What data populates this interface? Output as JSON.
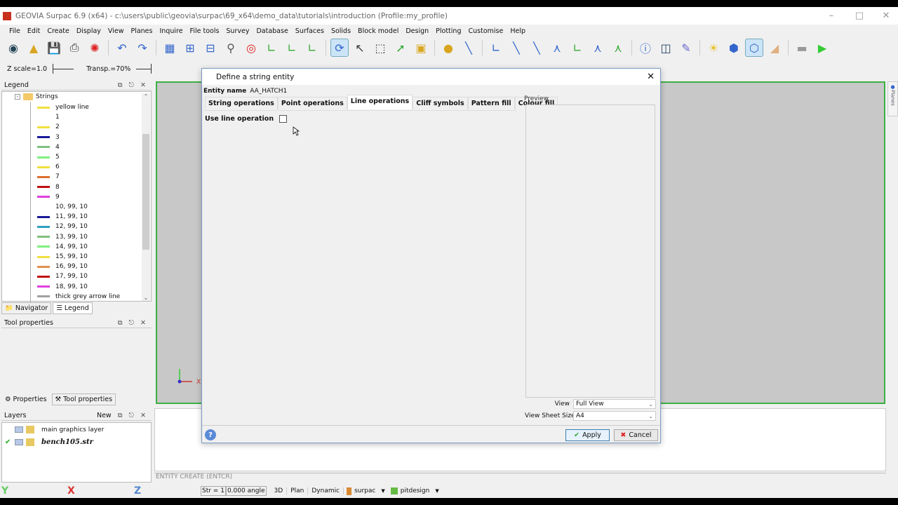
{
  "window": {
    "title": "GEOVIA Surpac 6.9 (x64) - c:\\users\\public\\geovia\\surpac\\69_x64\\demo_data\\tutorials\\introduction (Profile:my_profile)"
  },
  "menu": [
    "File",
    "Edit",
    "Create",
    "Display",
    "View",
    "Planes",
    "Inquire",
    "File tools",
    "Survey",
    "Database",
    "Surfaces",
    "Solids",
    "Block model",
    "Design",
    "Plotting",
    "Customise",
    "Help"
  ],
  "toolbar2": {
    "zscale": "Z scale=1.0",
    "transp": "Transp.=70%"
  },
  "legend": {
    "title": "Legend",
    "root": "Strings",
    "items": [
      {
        "label": "yellow line",
        "color": "#f0e040"
      },
      {
        "label": "1",
        "color": "#bbbbbb"
      },
      {
        "label": "2",
        "color": "#f0e040"
      },
      {
        "label": "3",
        "color": "#1a1a9a"
      },
      {
        "label": "4",
        "color": "#80c080"
      },
      {
        "label": "5",
        "color": "#80f080"
      },
      {
        "label": "6",
        "color": "#f0e040"
      },
      {
        "label": "7",
        "color": "#e07030"
      },
      {
        "label": "8",
        "color": "#c01010"
      },
      {
        "label": "9",
        "color": "#e040e0"
      },
      {
        "label": "10, 99, 10",
        "color": "#bbbbbb"
      },
      {
        "label": "11, 99, 10",
        "color": "#1a1a9a"
      },
      {
        "label": "12, 99, 10",
        "color": "#30a0c0"
      },
      {
        "label": "13, 99, 10",
        "color": "#80c080"
      },
      {
        "label": "14, 99, 10",
        "color": "#80f080"
      },
      {
        "label": "15, 99, 10",
        "color": "#f0e040"
      },
      {
        "label": "16, 99, 10",
        "color": "#e09050"
      },
      {
        "label": "17, 99, 10",
        "color": "#c01010"
      },
      {
        "label": "18, 99, 10",
        "color": "#e040e0"
      },
      {
        "label": "thick grey arrow line",
        "color": "#a0a0a0"
      }
    ],
    "tabs": [
      "Navigator",
      "Legend"
    ]
  },
  "tool_properties": {
    "title": "Tool properties",
    "tabs": [
      "Properties",
      "Tool properties"
    ]
  },
  "layers": {
    "title": "Layers",
    "new_label": "New",
    "items": [
      {
        "label": "main graphics layer",
        "checked": false
      },
      {
        "label": "bench105.str",
        "checked": true
      }
    ]
  },
  "command_line": "ENTITY CREATE (ENTCR)",
  "status": {
    "y": "Y",
    "x": "X",
    "z": "Z",
    "str": "Str = 1",
    "angle": "0.000 angle",
    "mode3d": "3D",
    "plan": "Plan",
    "dynamic": "Dynamic",
    "profile": "surpac",
    "function": "pitdesign"
  },
  "side_tab": "Planes",
  "dialog": {
    "title": "Define a string entity",
    "entity_label": "Entity name",
    "entity_value": "AA_HATCH1",
    "tabs": [
      "String operations",
      "Point operations",
      "Line operations",
      "Cliff symbols",
      "Pattern fill",
      "Colour fill"
    ],
    "active_tab": "Line operations",
    "use_line_operation_label": "Use line operation",
    "use_line_operation": false,
    "preview_label": "Preview",
    "view_label": "View",
    "view_value": "Full View",
    "sheet_label": "View Sheet Size",
    "sheet_value": "A4",
    "apply": "Apply",
    "cancel": "Cancel"
  }
}
